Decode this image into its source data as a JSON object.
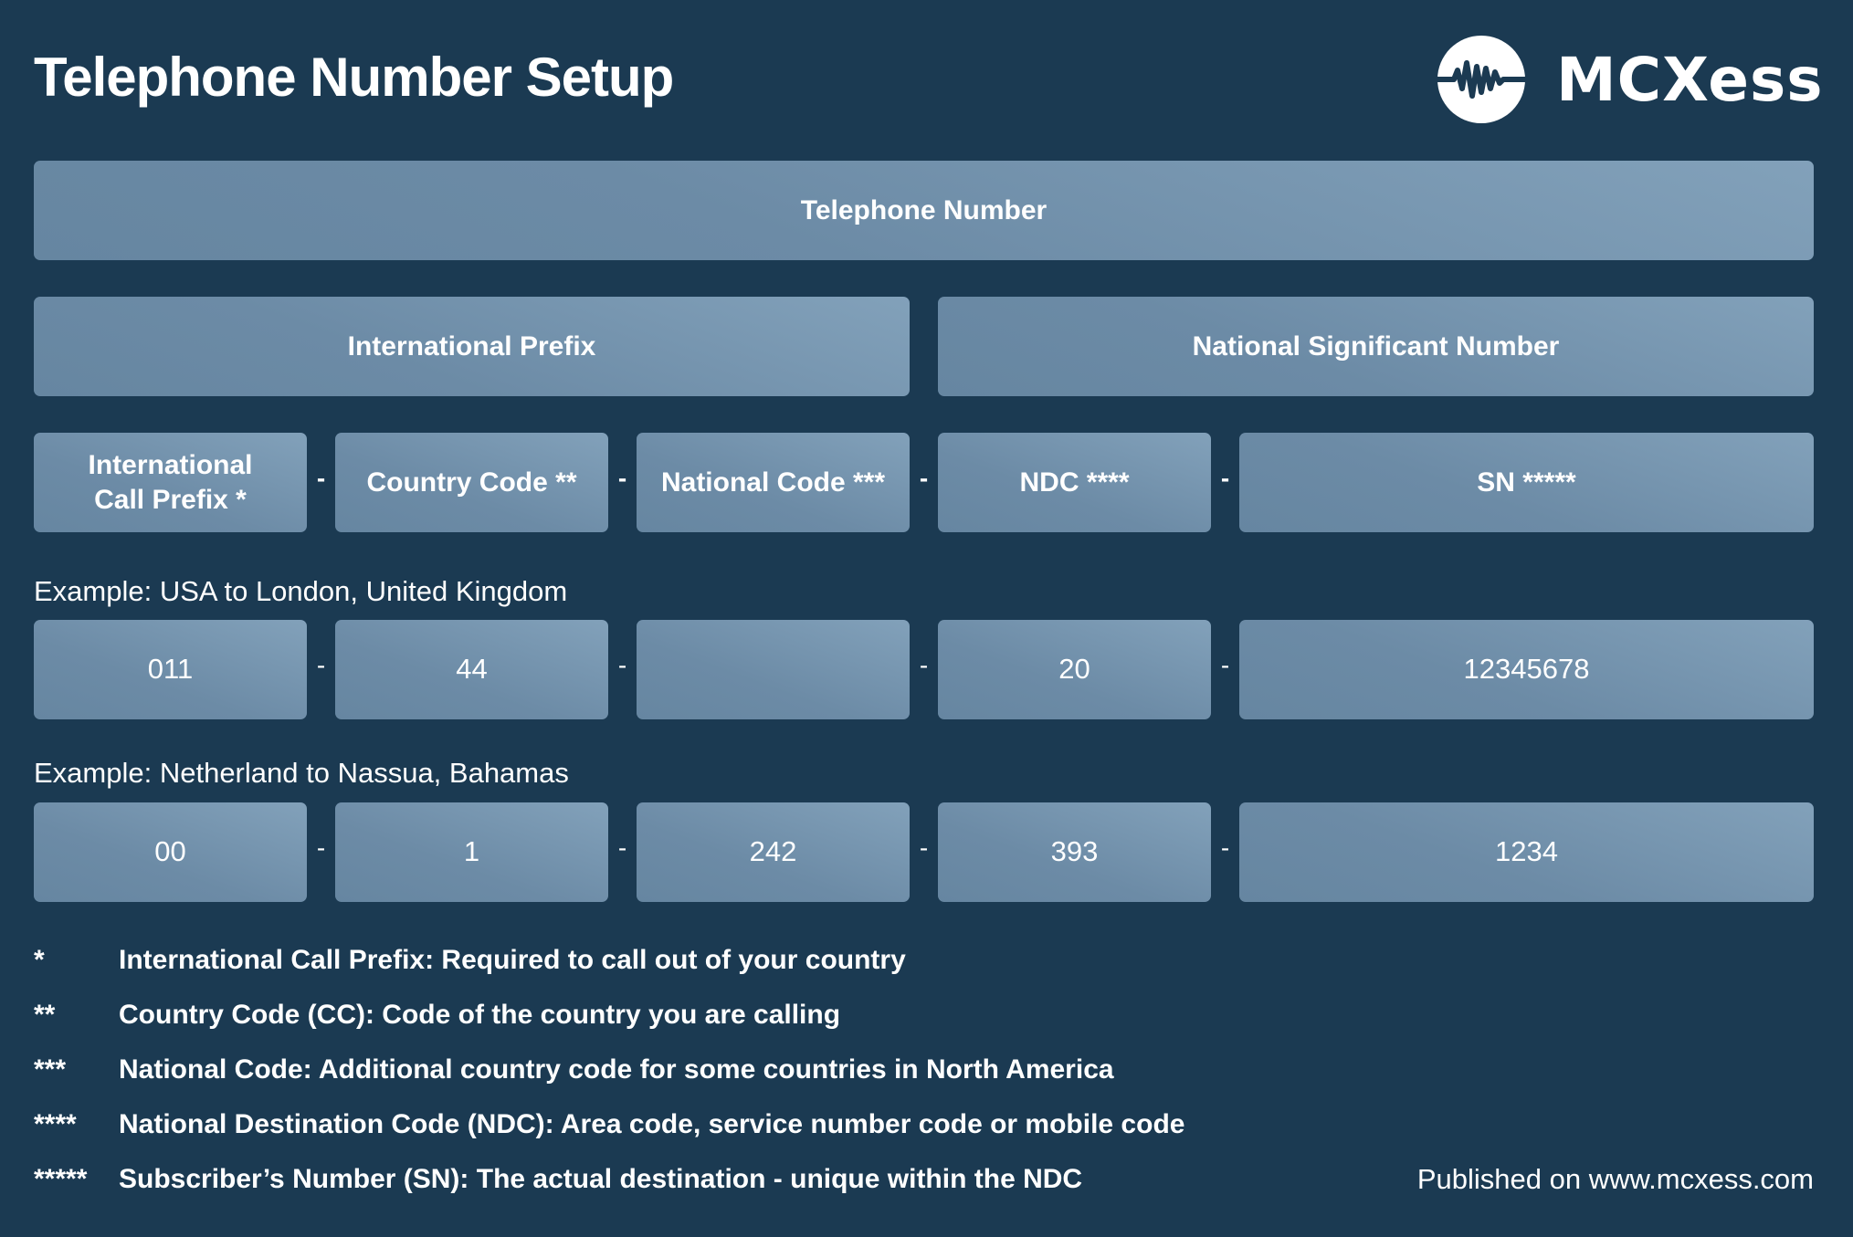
{
  "header": {
    "title": "Telephone Number Setup",
    "brand": "MCXess",
    "logo_icon": "waveform-circle-icon"
  },
  "levels": {
    "telephone_number": "Telephone Number",
    "international_prefix": "International Prefix",
    "national_significant_number": "National Significant Number"
  },
  "components": [
    {
      "line1": "International",
      "line2": "Call Prefix *"
    },
    {
      "label": "Country Code **"
    },
    {
      "label": "National Code ***"
    },
    {
      "label": "NDC ****"
    },
    {
      "label": "SN *****"
    }
  ],
  "separator": "-",
  "examples": [
    {
      "label": "Example: USA to London, United Kingdom",
      "values": [
        "011",
        "44",
        "",
        "20",
        "12345678"
      ]
    },
    {
      "label": "Example: Netherland to Nassua, Bahamas",
      "values": [
        "00",
        "1",
        "242",
        "393",
        "1234"
      ]
    }
  ],
  "footnotes": [
    {
      "mark": "*",
      "text": "International Call Prefix: Required to call out of your country"
    },
    {
      "mark": "**",
      "text": "Country Code (CC): Code of the country you are calling"
    },
    {
      "mark": "***",
      "text": "National Code: Additional country code for some countries in North America"
    },
    {
      "mark": "****",
      "text": "National Destination Code (NDC): Area code, service number code or mobile code"
    },
    {
      "mark": "*****",
      "text": "Subscriber’s Number (SN): The actual destination - unique within the NDC"
    }
  ],
  "footer": {
    "published": "Published on www.mcxess.com"
  },
  "colors": {
    "background": "#1b3a52",
    "box_light": "#82a1ba",
    "box_dark": "#6686a1",
    "text": "#ffffff"
  }
}
